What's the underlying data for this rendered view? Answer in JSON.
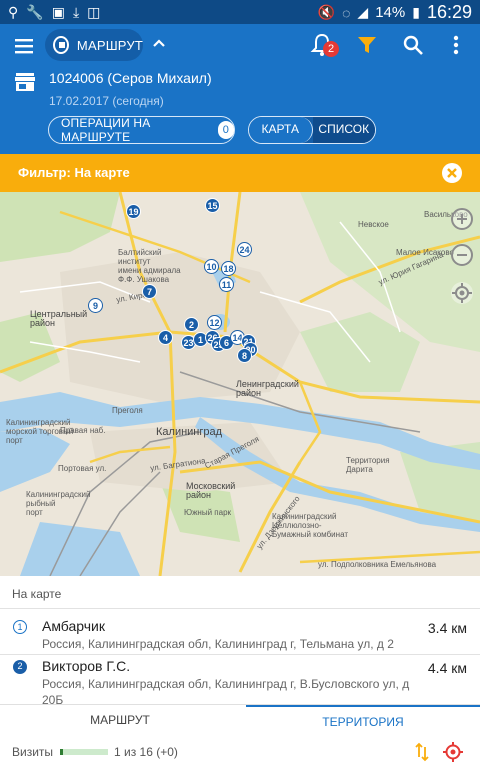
{
  "status_bar": {
    "icons_left": [
      "location-icon",
      "wrench-icon",
      "image-icon",
      "download-icon",
      "sd-card-icon"
    ],
    "battery_pct": "14%",
    "time": "16:29"
  },
  "appbar": {
    "route_label": "МАРШРУТ",
    "notifications_count": "2",
    "agent": "1024006 (Серов Михаил)",
    "date": "17.02.2017 (сегодня)",
    "ops_label": "ОПЕРАЦИИ НА МАРШРУТЕ",
    "ops_count": "0",
    "view_map": "КАРТА",
    "view_list": "СПИСОК",
    "colors": {
      "primary": "#1a73c6",
      "dark": "#0e4a86"
    }
  },
  "filter": {
    "label": "Фильтр: На карте",
    "color": "#f9ad0c"
  },
  "map": {
    "labels": {
      "district_central": "Центральный\nрайон",
      "district_leningrad": "Ленинградский\nрайон",
      "district_moscow": "Московский\nрайон",
      "city": "Калининград",
      "nevskoe": "Невское",
      "vasilkovo": "Васильково",
      "maloe_isakovo": "Малое Исаково",
      "baltic_institute": "Балтийский\nинститут\nимени адмирала\nФ.Ф. Ушакова",
      "sea_port": "Калининградский\nморской торговый\nпорт",
      "fishing_port": "Калининградский\nрыбный\nпорт",
      "south_park": "Южный парк",
      "darita": "Территория\nДарита",
      "gagarina": "ул. Юрия Гагарина",
      "kirova": "ул. Кирова",
      "pravaya_nab": "Правая наб.",
      "portovaya": "Портовая ул.",
      "bagrationa": "ул. Багратиона",
      "pregolya": "Преголя",
      "staraya_pregolya": "Старая Преголя",
      "dzerzhinskogo": "ул. Дзержинского",
      "podlozhnikova": "ул. Подполковника Емельянова",
      "paper_mill": "Калининградский\nЦеллюлозно-\nБумажный комбинат"
    },
    "pins": [
      {
        "n": "19",
        "style": "fill"
      },
      {
        "n": "15",
        "style": "fill"
      },
      {
        "n": "24",
        "style": "hollow"
      },
      {
        "n": "10",
        "style": "hollow"
      },
      {
        "n": "18",
        "style": "hollow"
      },
      {
        "n": "11",
        "style": "hollow"
      },
      {
        "n": "7",
        "style": "fill"
      },
      {
        "n": "9",
        "style": "hollow"
      },
      {
        "n": "12",
        "style": "hollow"
      },
      {
        "n": "2",
        "style": "fill"
      },
      {
        "n": "4",
        "style": "fill"
      },
      {
        "n": "23",
        "style": "fill"
      },
      {
        "n": "1",
        "style": "fill"
      },
      {
        "n": "26",
        "style": "fill"
      },
      {
        "n": "25",
        "style": "fill"
      },
      {
        "n": "6",
        "style": "fill"
      },
      {
        "n": "14",
        "style": "hollow"
      },
      {
        "n": "21",
        "style": "fill"
      },
      {
        "n": "20",
        "style": "fill"
      },
      {
        "n": "8",
        "style": "fill"
      }
    ]
  },
  "list": {
    "header": "На карте",
    "items": [
      {
        "num": "1",
        "name": "Амбарчик",
        "address": "Россия, Калининградская обл, Калининград г, Тельмана ул, д 2",
        "distance": "3.4 км"
      },
      {
        "num": "2",
        "name": "Викторов Г.С.",
        "address": "Россия, Калининградская обл, Калининград г, В.Бусловского ул, д 20Б",
        "distance": "4.4 км"
      }
    ]
  },
  "tabs": {
    "route": "МАРШРУТ",
    "territory": "ТЕРРИТОРИЯ"
  },
  "footer": {
    "visits_label": "Визиты",
    "progress": 0.0625,
    "visits_count": "1 из 16 (+0)"
  }
}
